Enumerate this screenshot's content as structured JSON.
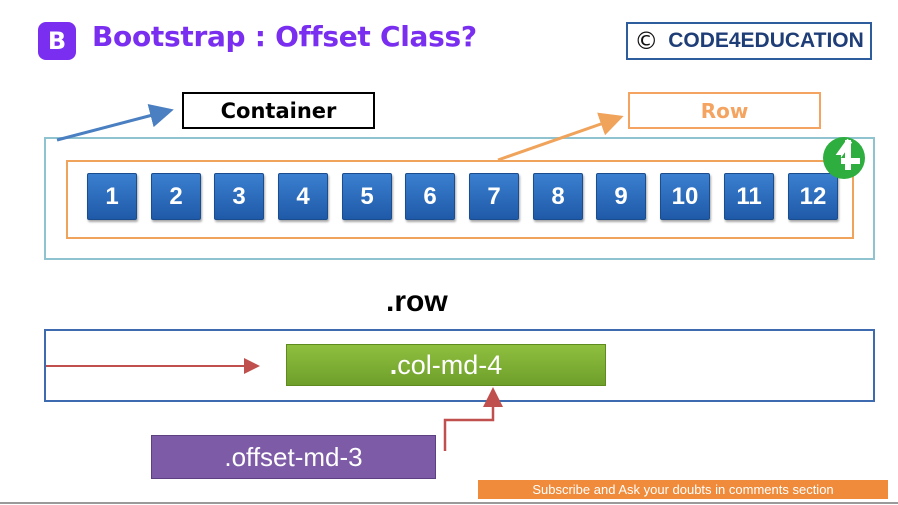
{
  "header": {
    "logo_letter": "B",
    "title": "Bootstrap : Offset Class?",
    "brand_copyright": "©",
    "brand_name": "CODE4EDUCATION"
  },
  "diagram_top": {
    "container_label": "Container",
    "row_label": "Row",
    "columns": [
      "1",
      "2",
      "3",
      "4",
      "5",
      "6",
      "7",
      "8",
      "9",
      "10",
      "11",
      "12"
    ]
  },
  "diagram_bottom": {
    "row_heading": ".row",
    "column_dot": ".",
    "column_label": "col-md-4",
    "offset_label": ".offset-md-3"
  },
  "footer": {
    "subscribe_text": "Subscribe and Ask your doubts in comments section"
  },
  "colors": {
    "brand_purple": "#7a2ff0",
    "column_blue": "#1f5aa8",
    "row_orange": "#f0a35b",
    "container_teal": "#8fc3cf",
    "col_green": "#7aa833",
    "offset_purple": "#7d5ba6",
    "arrow_red": "#c0504d"
  }
}
